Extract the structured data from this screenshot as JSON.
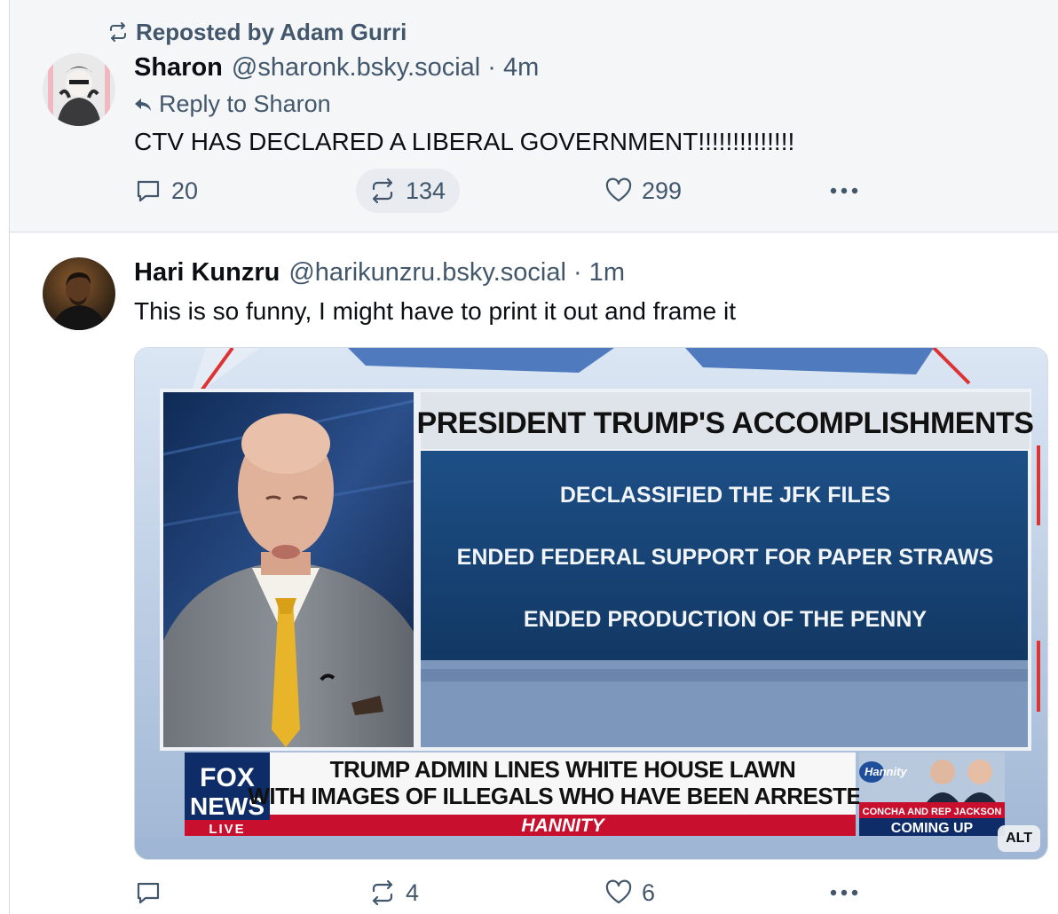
{
  "post1": {
    "repost_label": "Reposted by Adam Gurri",
    "author_name": "Sharon",
    "author_handle": "@sharonk.bsky.social · 4m",
    "reply_to": "Reply to Sharon",
    "text": "CTV HAS DECLARED A LIBERAL GOVERNMENT!!!!!!!!!!!!!!",
    "replies": "20",
    "reposts": "134",
    "likes": "299"
  },
  "post2": {
    "author_name": "Hari Kunzru",
    "author_handle": "@harikunzru.bsky.social · 1m",
    "text": "This is so funny, I might have to print it out and frame it",
    "image": {
      "heading": "PRESIDENT TRUMP'S ACCOMPLISHMENTS",
      "items": [
        "DECLASSIFIED THE JFK FILES",
        "ENDED FEDERAL SUPPORT FOR PAPER STRAWS",
        "ENDED PRODUCTION OF THE PENNY"
      ],
      "chyron_line1": "TRUMP ADMIN LINES WHITE HOUSE LAWN",
      "chyron_line2": "WITH IMAGES OF ILLEGALS WHO HAVE BEEN ARRESTED",
      "show_name": "HANNITY",
      "logo_line1": "FOX",
      "logo_line2": "NEWS",
      "logo_live": "LIVE",
      "promo_show": "Hannity",
      "promo_guests": "CONCHA AND REP JACKSON",
      "promo_coming": "COMING UP"
    },
    "alt_badge": "ALT",
    "replies": "",
    "reposts": "4",
    "likes": "6"
  },
  "icons": [
    "repost-icon",
    "reply-arrow-icon",
    "comment-icon",
    "heart-icon",
    "more-dots-icon"
  ],
  "colors": {
    "muted_text": "#42576c",
    "border": "#d4dbe2",
    "highlight_bg": "#f5f6f8"
  }
}
